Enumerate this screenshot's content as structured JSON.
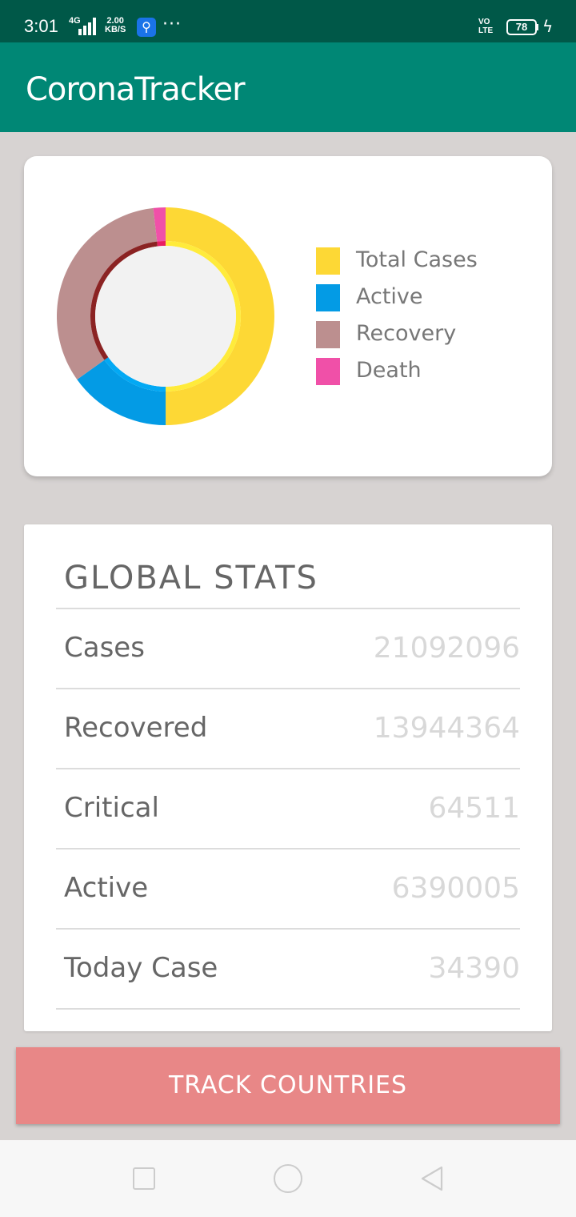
{
  "status_bar": {
    "time": "3:01",
    "network": "4G",
    "speed_value": "2.00",
    "speed_unit": "KB/S",
    "overflow": "···",
    "volte_top": "VO",
    "volte_bottom": "LTE",
    "battery": "78"
  },
  "app": {
    "title": "CoronaTracker"
  },
  "chart": {
    "legend": [
      {
        "label": "Total Cases",
        "color": "#fdd835"
      },
      {
        "label": "Active",
        "color": "#039be5"
      },
      {
        "label": "Recovery",
        "color": "#bc8f8f"
      },
      {
        "label": "Death",
        "color": "#f050a8"
      }
    ]
  },
  "chart_data": {
    "type": "pie",
    "categories": [
      "Total Cases",
      "Active",
      "Recovery",
      "Death"
    ],
    "values": [
      21092096,
      6390005,
      13944364,
      765336
    ],
    "colors": [
      "#fdd835",
      "#039be5",
      "#bc8f8f",
      "#f050a8"
    ],
    "inner_colors": [
      "#ffeb3b",
      "#03a9f4",
      "#8b2323",
      "#e91e63"
    ],
    "donut": true,
    "legend_position": "right"
  },
  "stats": {
    "title": "GLOBAL STATS",
    "rows": [
      {
        "label": "Cases",
        "value": "21092096"
      },
      {
        "label": "Recovered",
        "value": "13944364"
      },
      {
        "label": "Critical",
        "value": "64511"
      },
      {
        "label": "Active",
        "value": "6390005"
      },
      {
        "label": "Today Case",
        "value": "34390"
      }
    ]
  },
  "track_button": {
    "label": "TRACK COUNTRIES"
  },
  "icons": {
    "usb": "usb-icon",
    "charging": "bolt-icon",
    "nav_recents": "square-icon",
    "nav_home": "circle-icon",
    "nav_back": "triangle-back-icon"
  }
}
